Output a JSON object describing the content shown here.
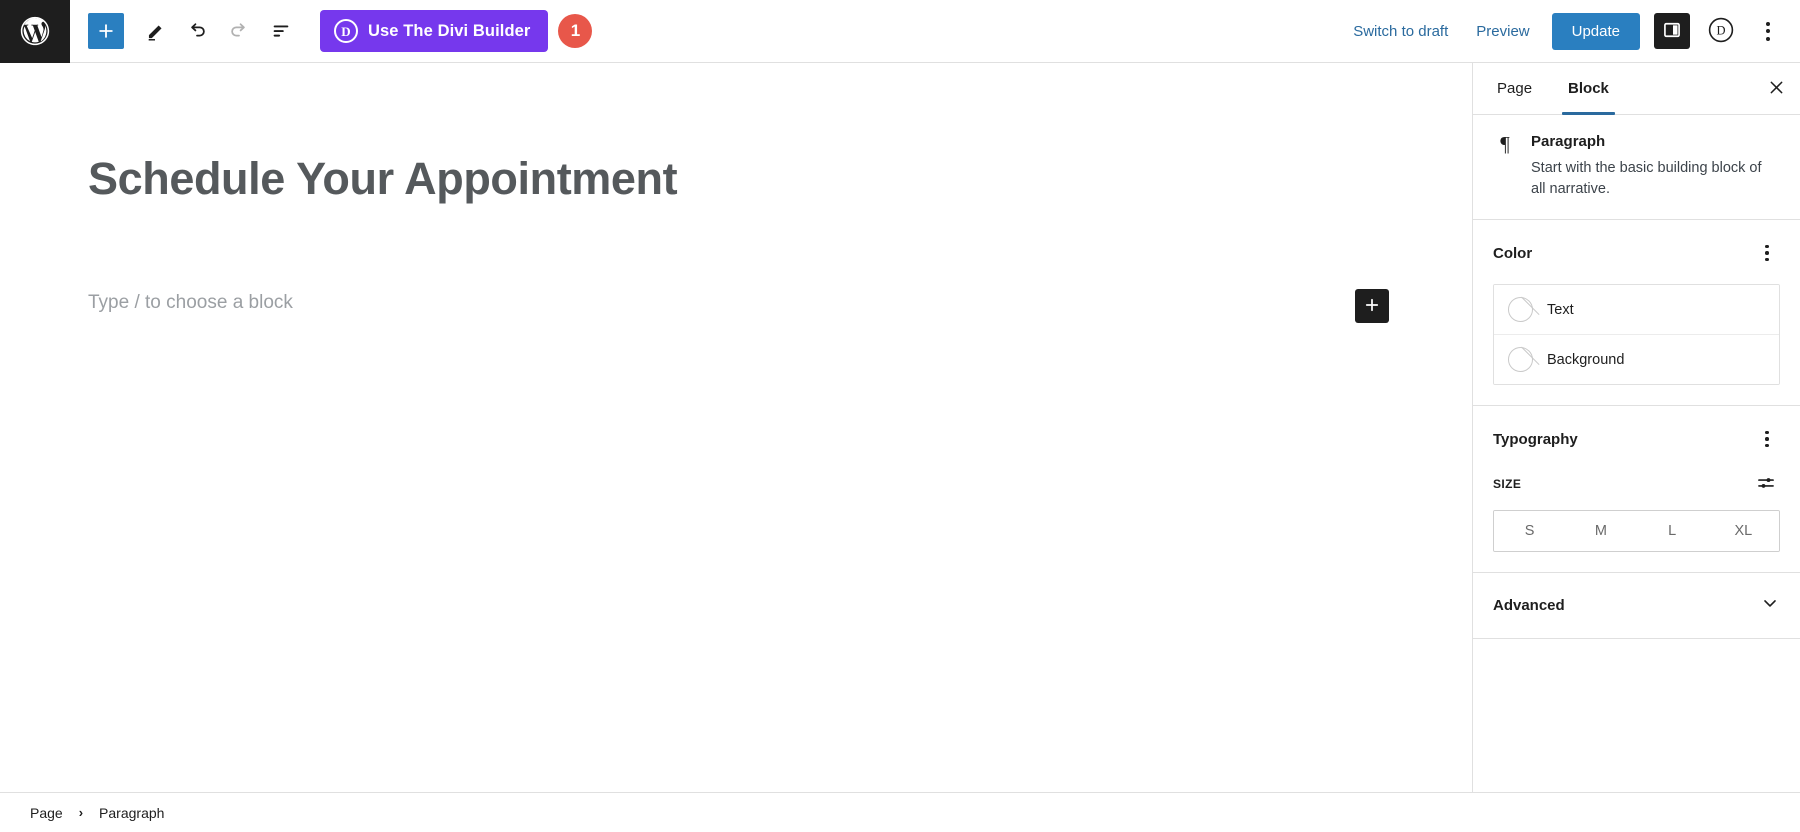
{
  "header": {
    "wp_logo_label": "wordpress-logo",
    "tools": [
      {
        "name": "add-block-button",
        "label": "Add block",
        "icon": "plus-icon"
      },
      {
        "name": "edit-tool-button",
        "label": "Tools",
        "icon": "pencil-icon"
      },
      {
        "name": "undo-button",
        "label": "Undo",
        "icon": "undo-icon"
      },
      {
        "name": "redo-button",
        "label": "Redo",
        "icon": "redo-icon"
      },
      {
        "name": "list-view-button",
        "label": "List view",
        "icon": "list-view-icon"
      }
    ],
    "divi_button": {
      "label": "Use The Divi Builder",
      "mark": "D",
      "color": "#7638ed"
    },
    "notification_badge": "1",
    "notification_color": "#e8574a",
    "switch_to_draft": "Switch to draft",
    "preview": "Preview",
    "update": "Update",
    "update_color": "#2a7fc0",
    "settings_toggle_label": "Settings",
    "divi_icon_label": "D",
    "options_label": "Options"
  },
  "editor": {
    "post_title": "Schedule Your Appointment",
    "paragraph_placeholder": "Type / to choose a block",
    "appender_label": "Add block"
  },
  "sidebar": {
    "tabs": [
      {
        "label": "Page",
        "active": false
      },
      {
        "label": "Block",
        "active": true
      }
    ],
    "close_label": "Close settings",
    "block_card": {
      "icon_glyph": "¶",
      "title": "Paragraph",
      "description": "Start with the basic building block of all narrative."
    },
    "color": {
      "title": "Color",
      "options_label": "Color options",
      "rows": [
        {
          "label": "Text"
        },
        {
          "label": "Background"
        }
      ]
    },
    "typography": {
      "title": "Typography",
      "options_label": "Typography options",
      "size_label": "SIZE",
      "size_toggle_label": "Set custom size",
      "sizes": [
        "S",
        "M",
        "L",
        "XL"
      ]
    },
    "advanced": {
      "title": "Advanced",
      "expand_label": "Expand"
    },
    "accent_color": "#2a6a9e"
  },
  "footer": {
    "breadcrumbs": [
      "Page",
      "Paragraph"
    ],
    "separator": "›"
  }
}
